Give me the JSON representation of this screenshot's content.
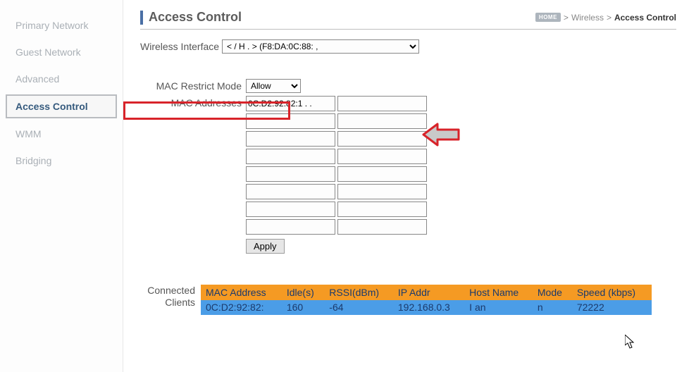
{
  "sidebar": {
    "items": [
      {
        "label": "Primary Network"
      },
      {
        "label": "Guest Network"
      },
      {
        "label": "Advanced"
      },
      {
        "label": "Access Control"
      },
      {
        "label": "WMM"
      },
      {
        "label": "Bridging"
      }
    ]
  },
  "header": {
    "title": "Access Control",
    "crumb_home": "HOME",
    "crumb_sep1": ">",
    "crumb_section": "Wireless",
    "crumb_sep2": ">",
    "crumb_current": "Access Control"
  },
  "wireless_interface": {
    "label": "Wireless Interface",
    "selected": "< / H           . > (F8:DA:0C:88:      ,"
  },
  "mac_restrict": {
    "label": "MAC Restrict Mode",
    "selected": "Allow"
  },
  "mac_addresses": {
    "label": "MAC Addresses",
    "grid": [
      "0C:D2:92:82:1 . .  ",
      "",
      "",
      "",
      "",
      "",
      "",
      "",
      "",
      "",
      "",
      "",
      "",
      "",
      "",
      ""
    ],
    "apply": "Apply"
  },
  "clients": {
    "label": "Connected Clients",
    "label_line1": "Connected",
    "label_line2": "Clients",
    "headers": [
      "MAC Address",
      "Idle(s)",
      "RSSI(dBm)",
      "IP Addr",
      "Host Name",
      "Mode",
      "Speed (kbps)"
    ],
    "rows": [
      {
        "mac": "0C:D2:92:82:     ",
        "idle": "160",
        "rssi": "-64",
        "ip": "192.168.0.3",
        "host": "I    an",
        "mode": "n",
        "speed": "72222"
      }
    ]
  }
}
